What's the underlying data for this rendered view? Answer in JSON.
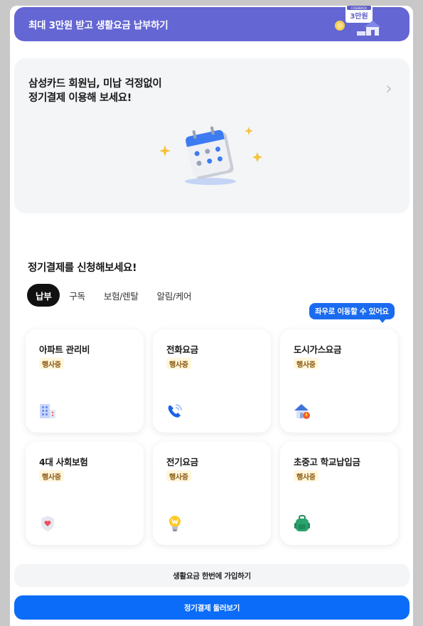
{
  "promo": {
    "text": "최대 3만원 받고 생활요금 납부하기",
    "badge_small": "CASHBACK",
    "badge_amount": "3만원",
    "accent": "#6466d3"
  },
  "hero": {
    "title": "삼성카드 회원님, 미납 걱정없이\n정기결제 이용해 보세요!",
    "chevron_icon": "chevron-right-icon",
    "art_icon": "calendar-icon"
  },
  "section": {
    "title": "정기결제를 신청해보세요!"
  },
  "tabs": [
    {
      "label": "납부",
      "active": true
    },
    {
      "label": "구독",
      "active": false
    },
    {
      "label": "보험/렌탈",
      "active": false
    },
    {
      "label": "알림/케어",
      "active": false
    }
  ],
  "tooltip": {
    "text": "좌우로 이동할 수 있어요",
    "color": "#1a6bf0"
  },
  "bills": [
    {
      "name": "아파트 관리비",
      "badge": "행사중",
      "icon": "apartment-building-icon"
    },
    {
      "name": "전화요금",
      "badge": "행사중",
      "icon": "phone-icon"
    },
    {
      "name": "도시가스요금",
      "badge": "행사중",
      "icon": "gas-house-icon"
    },
    {
      "name": "4대 사회보험",
      "badge": "행사중",
      "icon": "shield-heart-icon"
    },
    {
      "name": "전기요금",
      "badge": "행사중",
      "icon": "lightbulb-icon"
    },
    {
      "name": "초중고 학교납입금",
      "badge": "행사중",
      "icon": "backpack-icon"
    }
  ],
  "buttons": {
    "join": "생활요금 한번에 가입하기",
    "browse": "정기결제 둘러보기",
    "primary_color": "#0a6cf8"
  }
}
